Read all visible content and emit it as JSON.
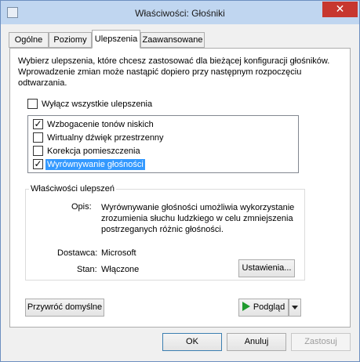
{
  "window": {
    "title": "Właściwości: Głośniki"
  },
  "tabs": [
    "Ogólne",
    "Poziomy",
    "Ulepszenia",
    "Zaawansowane"
  ],
  "description": "Wybierz ulepszenia, które chcesz zastosować dla bieżącej konfiguracji głośników. Wprowadzenie zmian może nastąpić dopiero przy następnym rozpoczęciu odtwarzania.",
  "disable_all": {
    "label": "Wyłącz wszystkie ulepszenia",
    "checked": false
  },
  "enhancements": [
    {
      "label": "Wzbogacenie tonów niskich",
      "checked": true
    },
    {
      "label": "Wirtualny dźwięk przestrzenny",
      "checked": false
    },
    {
      "label": "Korekcja pomieszczenia",
      "checked": false
    },
    {
      "label": "Wyrównywanie głośności",
      "checked": true,
      "selected": true
    }
  ],
  "properties": {
    "title": "Właściwości ulepszeń",
    "description_label": "Opis:",
    "description_text": "Wyrównywanie głośności umożliwia wykorzystanie zrozumienia słuchu ludzkiego w celu zmniejszenia postrzeganych różnic głośności.",
    "provider_label": "Dostawca:",
    "provider_value": "Microsoft",
    "state_label": "Stan:",
    "state_value": "Włączone",
    "settings_button": "Ustawienia..."
  },
  "restore_button": "Przywróć domyślne",
  "preview_button": "Podgląd",
  "footer": {
    "ok": "OK",
    "cancel": "Anuluj",
    "apply": "Zastosuj"
  },
  "colors": {
    "selection": "#3399ff",
    "play": "#1f9a2e",
    "close": "#c7372f"
  }
}
